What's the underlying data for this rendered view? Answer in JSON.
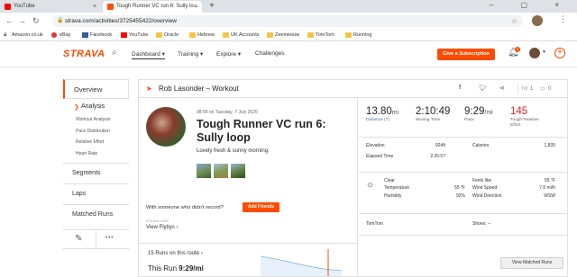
{
  "browser": {
    "tabs": [
      {
        "title": "YouTube",
        "close": "×"
      },
      {
        "title": "Tough Runner VC run 6: Sully lo...",
        "close": "×"
      }
    ],
    "new_tab": "+",
    "window_controls": "– ▢ ×",
    "url": "strava.com/activities/3725455422/overview",
    "bookmarks": [
      "Amazon.co.uk",
      "eBay",
      "Facebook",
      "YouTube",
      "Oracle",
      "Hebrew",
      "UK Accounts",
      "Zeemeeuw",
      "TomTom",
      "Running"
    ],
    "colors": {
      "brand": "#fc4c02"
    }
  },
  "header": {
    "logo": "STRAVA",
    "nav": [
      "Dashboard ▾",
      "Training ▾",
      "Explore ▾",
      "Challenges"
    ],
    "subscription": "Give a Subscription",
    "notif_count": "0"
  },
  "sidebar": {
    "overview": "Overview",
    "analysis": "Analysis",
    "analysis_items": [
      "Workout Analysis",
      "Pace Distribution",
      "Relative Effort",
      "Heart Rate"
    ],
    "segments": "Segments",
    "laps": "Laps",
    "matched_runs": "Matched Runs",
    "edit_icon": "✎",
    "more_icon": "•••"
  },
  "activity": {
    "header_title": "Rob Lasonder – Workout",
    "kudos": "1",
    "comments": "0",
    "date": "08:00 on Tuesday, 7 July 2020",
    "name": "Tough Runner VC run 6: Sully loop",
    "description": "Lovely fresh & sunny morning.",
    "who_text": "With someone who didn't record?",
    "add_friends": "Add Friends",
    "laps_label": "STRAVA LABS",
    "view_flyby": "View Flybys ›",
    "runs_on_route": "15 Runs on this route ›",
    "this_run_label": "This Run",
    "this_run_value": "9:29/mi",
    "view_matched": "View Matched Runs"
  },
  "stats": {
    "distance": {
      "value": "13.80",
      "unit": "mi",
      "label": "Distance (?)"
    },
    "moving_time": {
      "value": "2:10:49",
      "label": "Moving Time"
    },
    "pace": {
      "value": "9:29",
      "unit": "/mi",
      "label": "Pace"
    },
    "relative": {
      "value": "145",
      "label": "Tough Relative Effort"
    },
    "elevation": {
      "label": "Elevation",
      "value": "924ft"
    },
    "elapsed": {
      "label": "Elapsed Time",
      "value": "2:26:57"
    },
    "calories": {
      "label": "Calories",
      "value": "1,835"
    },
    "weather": {
      "condition": "Clear",
      "temperature": {
        "label": "Temperature",
        "value": "55 °F"
      },
      "humidity": {
        "label": "Humidity",
        "value": "92%"
      },
      "feels_like": {
        "label": "Feels like",
        "value": "55 °F"
      },
      "wind_speed": {
        "label": "Wind Speed",
        "value": "7.6 mi/h"
      },
      "wind_direction": {
        "label": "Wind Direction",
        "value": "WSW"
      }
    },
    "device": "TomTom",
    "shoes": "Shoes: --"
  }
}
